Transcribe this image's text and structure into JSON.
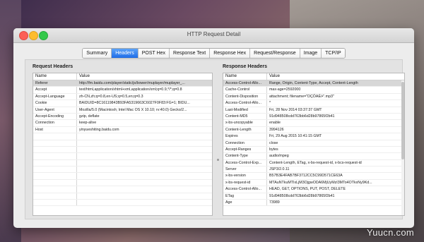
{
  "window": {
    "title": "HTTP Request Detail"
  },
  "tabs": [
    {
      "label": "Summary",
      "active": false
    },
    {
      "label": "Headers",
      "active": true
    },
    {
      "label": "POST Hex",
      "active": false
    },
    {
      "label": "Response Text",
      "active": false
    },
    {
      "label": "Response Hex",
      "active": false
    },
    {
      "label": "Request/Response",
      "active": false
    },
    {
      "label": "Image",
      "active": false
    },
    {
      "label": "TCP/IP",
      "active": false
    }
  ],
  "request": {
    "title": "Request Headers",
    "col_name": "Name",
    "col_value": "Value",
    "rows": [
      [
        "Referer",
        "http://fm.baidu.com/player/static/js/bower/muplayer/muplayer_..."
      ],
      [
        "Accept",
        "text/html,application/xhtml+xml,application/xml;q=0.9,*/*;q=0.8"
      ],
      [
        "Accept-Language",
        "zh-CN,zh;q=0.8,en-US;q=0.5,en;q=0.3"
      ],
      [
        "Cookie",
        "BAIDUID=8C16119843B93FA5319663C6027F0F83:FG=1; BIDU..."
      ],
      [
        "User-Agent",
        "Mozilla/5.0 (Macintosh; Intel Mac OS X 10.10; rv:40.0) Gecko/2..."
      ],
      [
        "Accept-Encoding",
        "gzip, deflate"
      ],
      [
        "Connection",
        "keep-alive"
      ],
      [
        "Host",
        "yinyueshiting.baidu.com"
      ]
    ]
  },
  "response": {
    "title": "Response Headers",
    "col_name": "Name",
    "col_value": "Value",
    "rows": [
      [
        "Access-Control-Allo...",
        "Range, Origin, Content-Type, Accept, Content-Length"
      ],
      [
        "Cache-Control",
        "max-age=2592000"
      ],
      [
        "Content-Disposition",
        "attachment; filename=\"DÇÖAÉ/•\".mp3\""
      ],
      [
        "Access-Control-Allo...",
        "*"
      ],
      [
        "Last-Modified",
        "Fri, 28 Nov 2014 03:37:37 GMT"
      ],
      [
        "Content-MD5",
        "91d948508cdd763bb6d28b97865f2b41"
      ],
      [
        "x-bs-uncopyable",
        "enable"
      ],
      [
        "Content-Length",
        "3994126"
      ],
      [
        "Expires",
        "Fri, 29 Aug 2015 10:41:15 GMT"
      ],
      [
        "Connection",
        "close"
      ],
      [
        "Accept-Ranges",
        "bytes"
      ],
      [
        "Content-Type",
        "audio/mpeg"
      ],
      [
        "Access-Control-Exp...",
        "Content-Length, ETag, x-bs-request-id, x-bcs-request-id"
      ],
      [
        "Server",
        "JSP3/2.0.11"
      ],
      [
        "x-bs-version",
        "B57B3E4FAB7BF3712CC5C99D571CE63A"
      ],
      [
        "x-bs-request-id",
        "MTAuNTkuMTIxLjM3OjgwODA6MjUyMzI3MTo4OTkxNy9Kd..."
      ],
      [
        "Access-Control-Allo...",
        "HEAD, GET, OPTIONS, PUT, POST, DELETE"
      ],
      [
        "ETag",
        "91d948508cdd763bb6d28b97865f2b41"
      ],
      [
        "Age",
        "73989"
      ]
    ]
  },
  "watermark": "Yuucn.com"
}
